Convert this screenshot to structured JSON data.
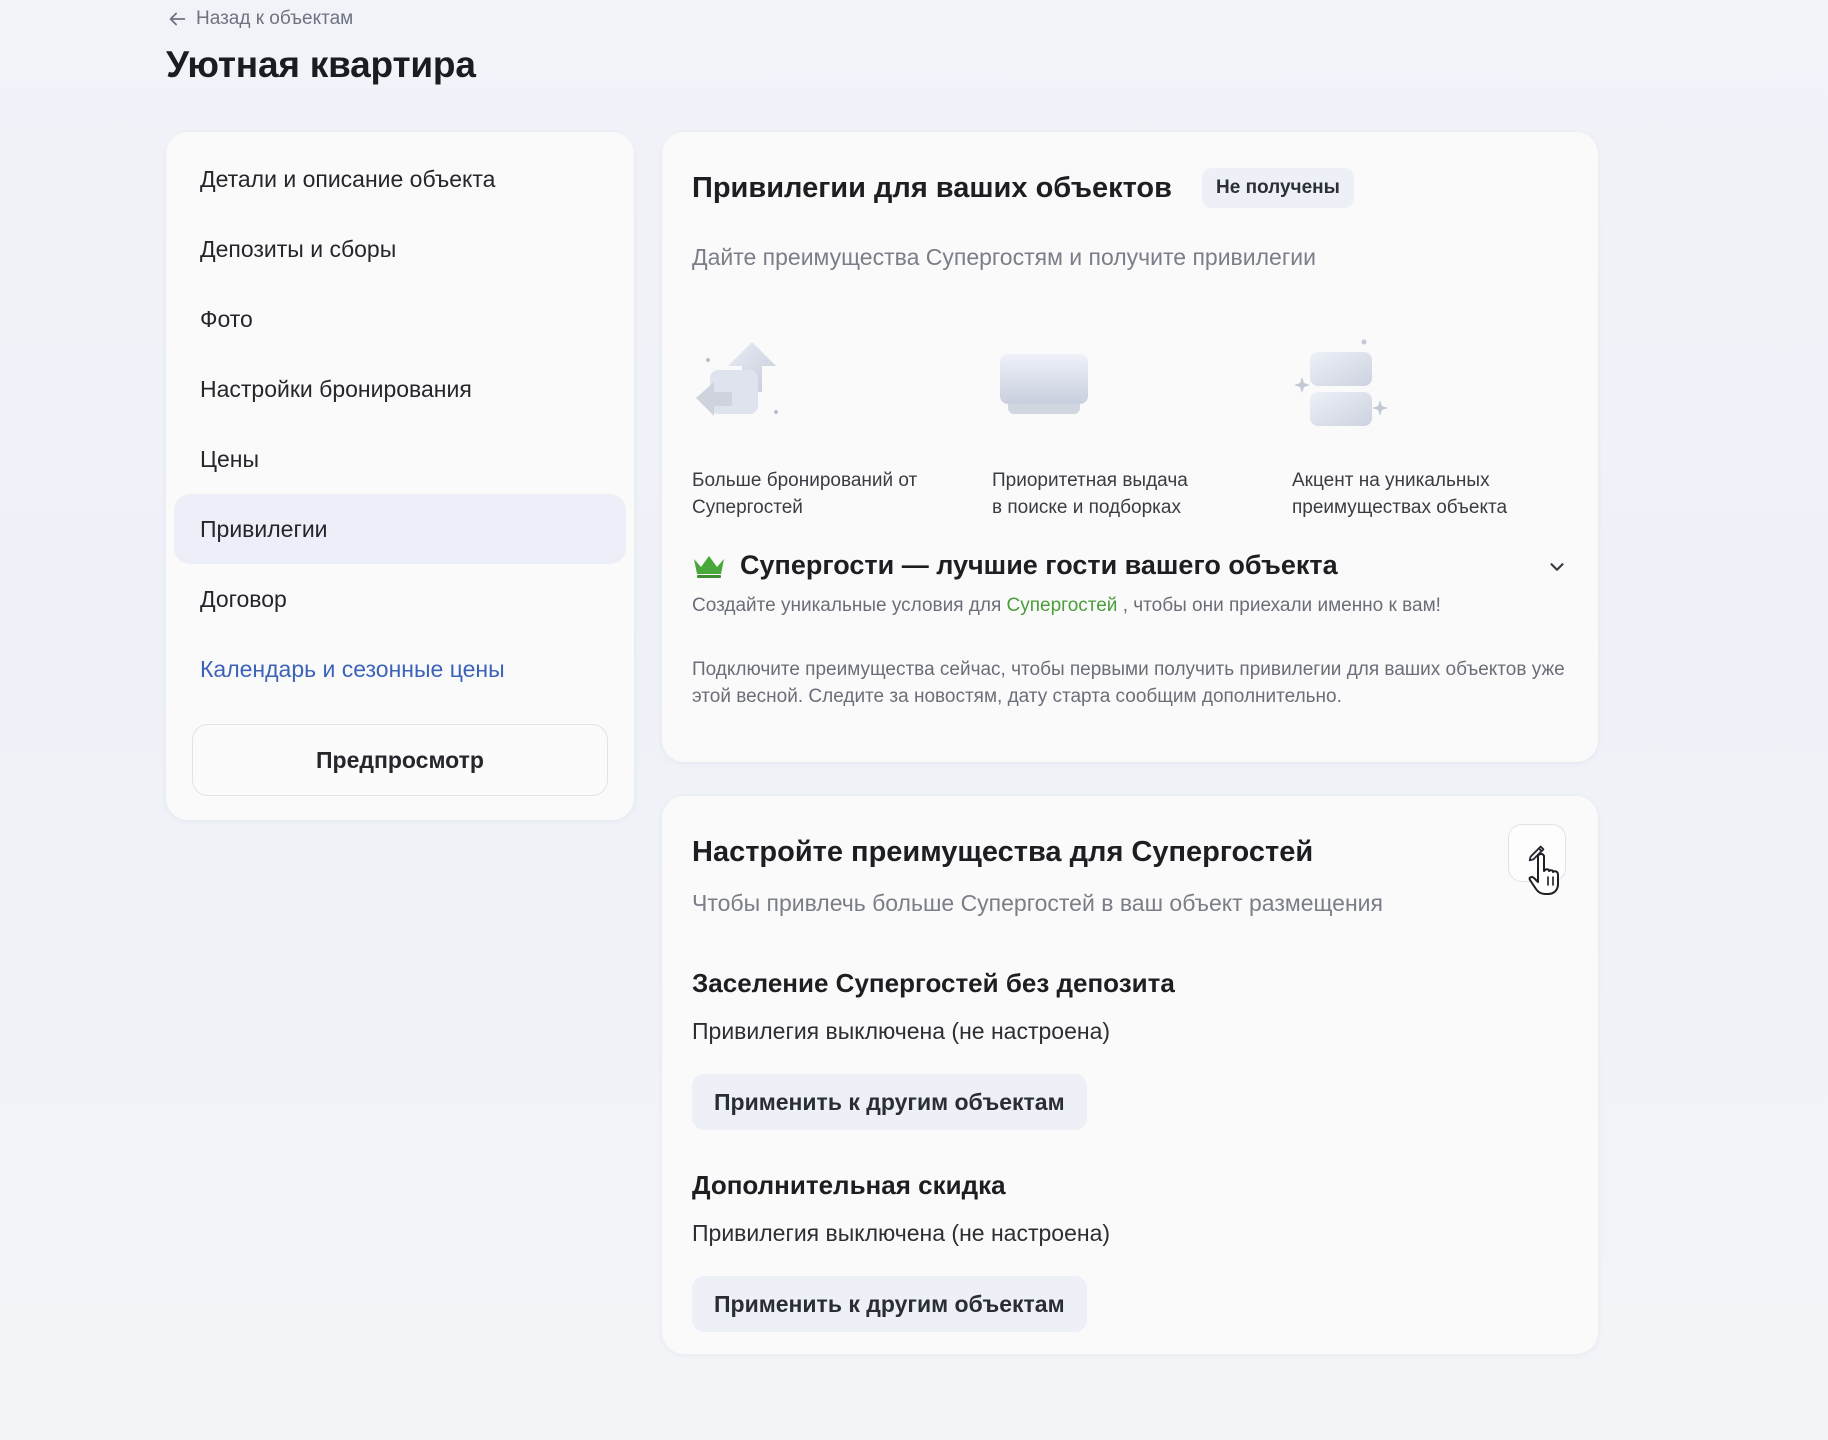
{
  "header": {
    "back_label": "Назад к объектам",
    "title": "Уютная квартира"
  },
  "sidebar": {
    "items": [
      {
        "label": "Детали и описание объекта"
      },
      {
        "label": "Депозиты и сборы"
      },
      {
        "label": "Фото"
      },
      {
        "label": "Настройки бронирования"
      },
      {
        "label": "Цены"
      },
      {
        "label": "Привилегии",
        "active": true
      },
      {
        "label": "Договор"
      },
      {
        "label": "Календарь и сезонные цены",
        "link": true
      }
    ],
    "preview_label": "Предпросмотр"
  },
  "privileges": {
    "title": "Привилегии для ваших объектов",
    "badge": "Не получены",
    "subtitle": "Дайте преимущества Супергостям и получите привилегии",
    "features": [
      {
        "icon": "bookings-arrows-icon",
        "line1": "Больше бронирований от",
        "line2": "Супергостей"
      },
      {
        "icon": "priority-card-icon",
        "line1": "Приоритетная выдача",
        "line2": "в поиске и подборках"
      },
      {
        "icon": "sparkle-cards-icon",
        "line1": "Акцент на уникальных",
        "line2": "преимуществах объекта"
      }
    ],
    "superguests": {
      "icon": "crown-icon",
      "title": "Супергости — лучшие гости вашего объекта",
      "text1_before": "Создайте уникальные условия для",
      "text1_link": "Супергостей",
      "text1_after": ", чтобы они приехали именно к вам!",
      "text2": "Подключите преимущества сейчас, чтобы первыми получить привилегии для ваших объектов уже этой весной. Следите за новостям, дату старта сообщим дополнительно."
    }
  },
  "config": {
    "title": "Настройте преимущества для Супергостей",
    "subtitle": "Чтобы привлечь больше Супергостей в ваш объект размещения",
    "sections": [
      {
        "title": "Заселение Супергостей без депозита",
        "status": "Привилегия выключена (не настроена)",
        "button": "Применить к другим объектам"
      },
      {
        "title": "Дополнительная скидка",
        "status": "Привилегия выключена (не настроена)",
        "button": "Применить к другим объектам"
      }
    ]
  },
  "colors": {
    "accent_link": "#3d63b8",
    "green": "#4a9e3a",
    "active_bg": "#eceff7"
  }
}
